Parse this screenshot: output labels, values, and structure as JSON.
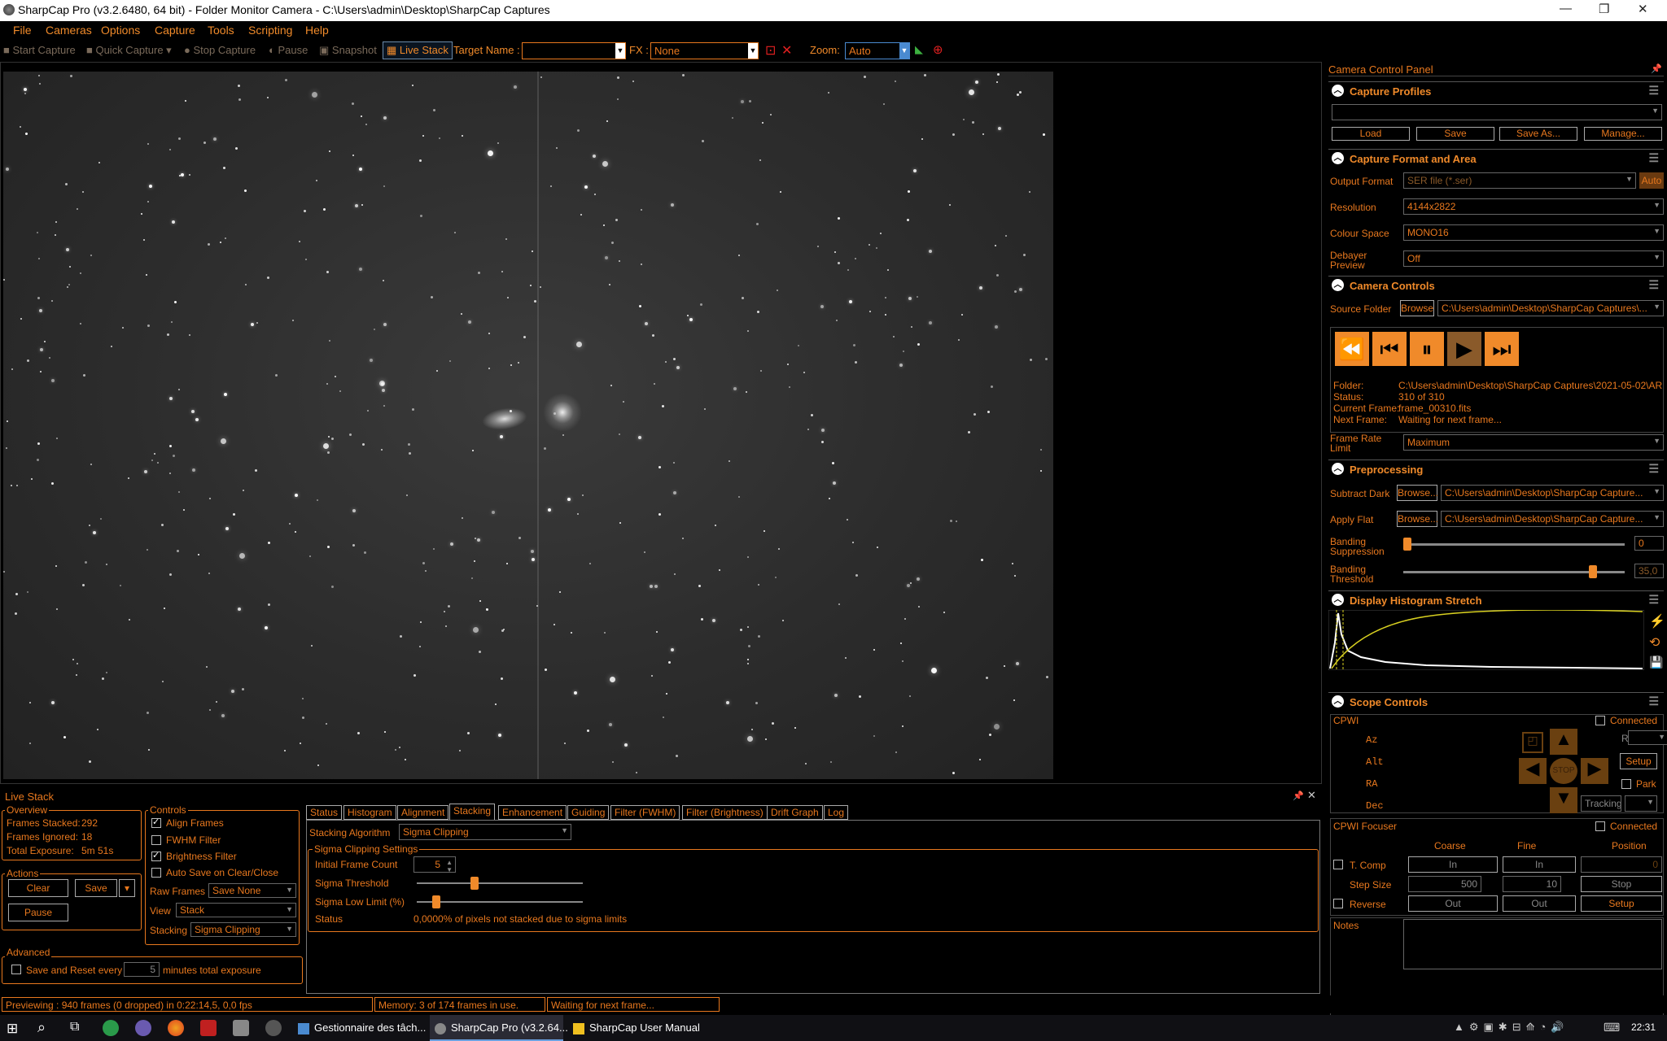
{
  "window": {
    "title": "SharpCap Pro (v3.2.6480, 64 bit) - Folder Monitor Camera - C:\\Users\\admin\\Desktop\\SharpCap Captures",
    "minimize": "—",
    "maximize": "❐",
    "close": "✕"
  },
  "menu": [
    "File",
    "Cameras",
    "Options",
    "Capture",
    "Tools",
    "Scripting",
    "Help"
  ],
  "toolbar": {
    "start_capture": "Start Capture",
    "quick_capture": "Quick Capture",
    "stop_capture": "Stop Capture",
    "pause": "Pause",
    "snapshot": "Snapshot",
    "live_stack": "Live Stack",
    "target_name_label": "Target Name :",
    "target_name_value": "",
    "fx_label": "FX :",
    "fx_value": "None",
    "zoom_label": "Zoom:",
    "zoom_value": "Auto"
  },
  "ccp": {
    "title": "Camera Control Panel",
    "capture_profiles": {
      "header": "Capture Profiles",
      "profile_value": "",
      "load": "Load",
      "save": "Save",
      "save_as": "Save As...",
      "manage": "Manage..."
    },
    "format": {
      "header": "Capture Format and Area",
      "output_format_label": "Output Format",
      "output_format_value": "SER file (*.ser)",
      "auto": "Auto",
      "resolution_label": "Resolution",
      "resolution_value": "4144x2822",
      "colour_space_label": "Colour Space",
      "colour_space_value": "MONO16",
      "debayer_label_1": "Debayer",
      "debayer_label_2": "Preview",
      "debayer_value": "Off"
    },
    "camera_controls": {
      "header": "Camera Controls",
      "source_folder_label": "Source Folder",
      "browse": "Browse",
      "source_folder_value": "C:\\Users\\admin\\Desktop\\SharpCap Captures\\...",
      "folder_label": "Folder:",
      "folder_value": "C:\\Users\\admin\\Desktop\\SharpCap Captures\\2021-05-02\\AR",
      "status_label": "Status:",
      "status_value": "310 of 310",
      "current_frame_label": "Current Frame:",
      "current_frame_value": "frame_00310.fits",
      "next_frame_label": "Next Frame:",
      "next_frame_value": "Waiting for next frame...",
      "frame_rate_label_1": "Frame Rate",
      "frame_rate_label_2": "Limit",
      "frame_rate_value": "Maximum"
    },
    "preprocessing": {
      "header": "Preprocessing",
      "subtract_dark_label": "Subtract Dark",
      "apply_flat_label": "Apply Flat",
      "browse": "Browse...",
      "dark_value": "C:\\Users\\admin\\Desktop\\SharpCap Capture...",
      "flat_value": "C:\\Users\\admin\\Desktop\\SharpCap Capture...",
      "banding_suppression_label_1": "Banding",
      "banding_suppression_label_2": "Suppression",
      "banding_suppression_value": "0",
      "banding_suppression_fraction": 0.0,
      "banding_threshold_label_1": "Banding",
      "banding_threshold_label_2": "Threshold",
      "banding_threshold_value": "35,0",
      "banding_threshold_fraction": 0.87
    },
    "histogram": {
      "header": "Display Histogram Stretch"
    },
    "scope": {
      "header": "Scope Controls",
      "connected_label": "Connected",
      "mount_name": "CPWI",
      "coords": [
        "Az",
        "Alt",
        "RA",
        "Dec"
      ],
      "rate_label": "Rate:",
      "setup": "Setup",
      "park": "Park",
      "stop": "STOP",
      "tracking": "Tracking"
    },
    "focuser": {
      "name": "CPWI Focuser",
      "connected_label": "Connected",
      "coarse": "Coarse",
      "fine": "Fine",
      "position": "Position",
      "t_comp": "T. Comp",
      "in": "In",
      "position_value": "0",
      "step_size": "Step Size",
      "coarse_step": "500",
      "fine_step": "10",
      "stop": "Stop",
      "reverse": "Reverse",
      "out": "Out",
      "setup": "Setup"
    },
    "notes_label": "Notes"
  },
  "live_stack": {
    "title": "Live Stack",
    "overview": {
      "label": "Overview",
      "frames_stacked_label": "Frames Stacked:",
      "frames_stacked": "292",
      "frames_ignored_label": "Frames Ignored:",
      "frames_ignored": "18",
      "total_exposure_label": "Total Exposure:",
      "total_exposure": "5m 51s"
    },
    "actions": {
      "label": "Actions",
      "clear": "Clear",
      "save": "Save",
      "pause": "Pause"
    },
    "controls": {
      "label": "Controls",
      "align_frames": "Align Frames",
      "fwhm_filter": "FWHM Filter",
      "brightness_filter": "Brightness Filter",
      "auto_save": "Auto Save on Clear/Close",
      "raw_frames_label": "Raw Frames",
      "raw_frames_value": "Save None",
      "view_label": "View",
      "view_value": "Stack",
      "stacking_label": "Stacking",
      "stacking_value": "Sigma Clipping"
    },
    "advanced": {
      "label": "Advanced",
      "save_reset_label": "Save and Reset every",
      "save_reset_value": "5",
      "minutes_label": "minutes total exposure"
    },
    "tabs": [
      "Status",
      "Histogram",
      "Alignment",
      "Stacking",
      "Enhancement",
      "Guiding",
      "Filter (FWHM)",
      "Filter (Brightness)",
      "Drift Graph",
      "Log"
    ],
    "active_tab": "Stacking",
    "stacking": {
      "algorithm_label": "Stacking Algorithm",
      "algorithm_value": "Sigma Clipping",
      "settings_label": "Sigma Clipping Settings",
      "initial_frame_count_label": "Initial Frame Count",
      "initial_frame_count": "5",
      "sigma_threshold_label": "Sigma Threshold",
      "sigma_threshold_fraction": 0.34,
      "sigma_low_label": "Sigma Low Limit (%)",
      "sigma_low_fraction": 0.1,
      "status_label": "Status",
      "status_value": "0,0000% of pixels not stacked due to sigma limits"
    }
  },
  "statusbar": {
    "previewing": "Previewing : 940 frames (0 dropped) in 0:22:14,5, 0,0 fps",
    "memory": "Memory: 3 of 174 frames in use.",
    "waiting": "Waiting for next frame..."
  },
  "taskbar": {
    "task_manager": "Gestionnaire des tâch...",
    "sharpcap": "SharpCap Pro (v3.2.64...",
    "manual": "SharpCap User Manual",
    "clock": "22:31"
  },
  "colors": {
    "accent": "#e8781e",
    "background": "#000000"
  }
}
